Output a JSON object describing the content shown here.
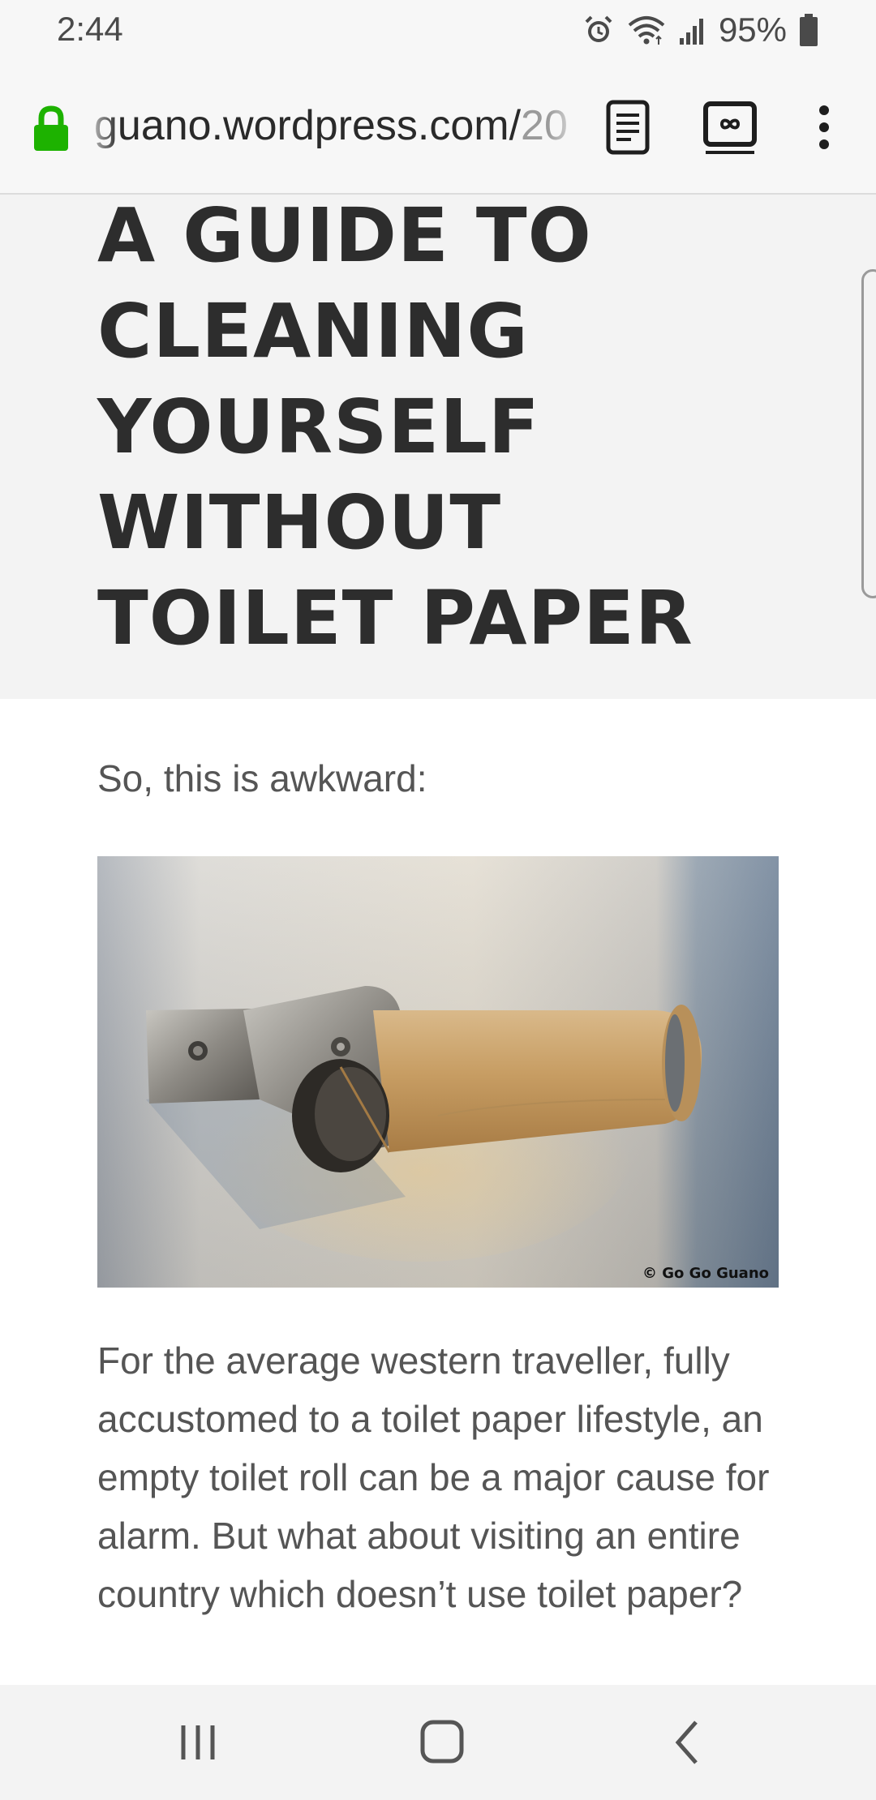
{
  "status_bar": {
    "time": "2:44",
    "battery_percent": "95%",
    "icons": [
      "alarm-icon",
      "wifi-icon",
      "signal-icon",
      "battery-icon"
    ]
  },
  "browser": {
    "url_domain": "guano.wordpress.com/",
    "url_path": "20",
    "secure": true,
    "lock_color": "#1db200",
    "buttons": [
      "reader-mode-icon",
      "tabs-icon",
      "more-menu-icon"
    ]
  },
  "article": {
    "title": "A GUIDE TO CLEANING YOURSELF WITHOUT TOILET PAPER",
    "intro": "So, this is awkward:",
    "image_caption": "© Go Go Guano",
    "body": "For the average western traveller, fully accustomed to a toilet paper lifestyle, an empty toilet roll can be a major cause for alarm. But what about visiting an entire country which doesn’t use toilet paper?"
  },
  "nav_bar": {
    "buttons": [
      "recents-icon",
      "home-icon",
      "back-icon"
    ]
  }
}
